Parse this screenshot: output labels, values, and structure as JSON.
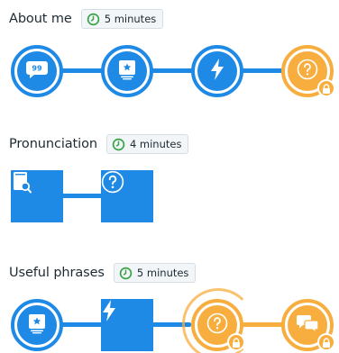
{
  "sections": [
    {
      "title": "About me",
      "duration": "5 minutes",
      "nodes": [
        {
          "icon": "speech-bubble-icon",
          "state": "active"
        },
        {
          "icon": "flashcard-icon",
          "state": "active"
        },
        {
          "icon": "lightning-icon",
          "state": "active"
        },
        {
          "icon": "question-icon",
          "state": "locked"
        }
      ]
    },
    {
      "title": "Pronunciation",
      "duration": "4 minutes",
      "nodes": [
        {
          "icon": "book-search-icon",
          "state": "active"
        },
        {
          "icon": "question-icon",
          "state": "active"
        }
      ]
    },
    {
      "title": "Useful phrases",
      "duration": "5 minutes",
      "nodes": [
        {
          "icon": "flashcard-icon",
          "state": "active"
        },
        {
          "icon": "lightning-icon",
          "state": "active"
        },
        {
          "icon": "question-icon",
          "state": "locked-current"
        },
        {
          "icon": "chat-bubbles-icon",
          "state": "locked"
        }
      ]
    }
  ],
  "colors": {
    "blue": "#1f8ae6",
    "orange": "#f7ae3f"
  }
}
